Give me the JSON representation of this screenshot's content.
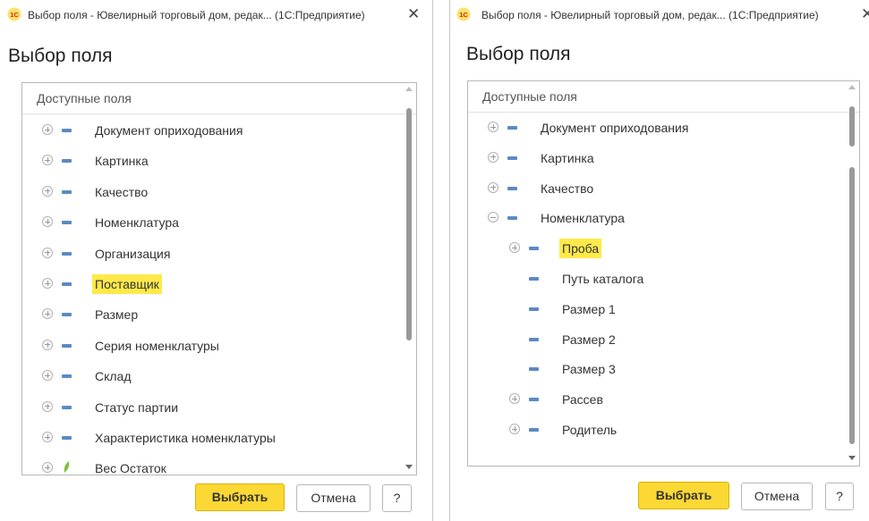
{
  "windows": [
    {
      "title": "Выбор поля - Ювелирный торговый дом, редак... (1С:Предприятие)",
      "form_title": "Выбор поля",
      "panel_header": "Доступные поля",
      "items": [
        {
          "label": "Документ оприходования",
          "expander": "plus",
          "icon": "dash",
          "level": 0
        },
        {
          "label": "Картинка",
          "expander": "plus",
          "icon": "dash",
          "level": 0
        },
        {
          "label": "Качество",
          "expander": "plus",
          "icon": "dash",
          "level": 0
        },
        {
          "label": "Номенклатура",
          "expander": "plus",
          "icon": "dash",
          "level": 0
        },
        {
          "label": "Организация",
          "expander": "plus",
          "icon": "dash",
          "level": 0
        },
        {
          "label": "Поставщик",
          "expander": "plus",
          "icon": "dash",
          "level": 0,
          "selected": true
        },
        {
          "label": "Размер",
          "expander": "plus",
          "icon": "dash",
          "level": 0
        },
        {
          "label": "Серия номенклатуры",
          "expander": "plus",
          "icon": "dash",
          "level": 0
        },
        {
          "label": "Склад",
          "expander": "plus",
          "icon": "dash",
          "level": 0
        },
        {
          "label": "Статус партии",
          "expander": "plus",
          "icon": "dash",
          "level": 0
        },
        {
          "label": "Характеристика номенклатуры",
          "expander": "plus",
          "icon": "dash",
          "level": 0
        },
        {
          "label": "Вес Остаток",
          "expander": "plus",
          "icon": "leaf",
          "level": 0
        }
      ],
      "buttons": {
        "select": "Выбрать",
        "cancel": "Отмена",
        "help": "?"
      }
    },
    {
      "title": "Выбор поля - Ювелирный торговый дом, редак... (1С:Предприятие)",
      "form_title": "Выбор поля",
      "panel_header": "Доступные поля",
      "items": [
        {
          "label": "Документ оприходования",
          "expander": "plus",
          "icon": "dash",
          "level": 0
        },
        {
          "label": "Картинка",
          "expander": "plus",
          "icon": "dash",
          "level": 0
        },
        {
          "label": "Качество",
          "expander": "plus",
          "icon": "dash",
          "level": 0
        },
        {
          "label": "Номенклатура",
          "expander": "minus",
          "icon": "dash",
          "level": 0
        },
        {
          "label": "Проба",
          "expander": "plus",
          "icon": "dash",
          "level": 1,
          "selected": true
        },
        {
          "label": "Путь каталога",
          "expander": "none",
          "icon": "dash",
          "level": 1
        },
        {
          "label": "Размер 1",
          "expander": "none",
          "icon": "dash",
          "level": 1
        },
        {
          "label": "Размер 2",
          "expander": "none",
          "icon": "dash",
          "level": 1
        },
        {
          "label": "Размер 3",
          "expander": "none",
          "icon": "dash",
          "level": 1
        },
        {
          "label": "Рассев",
          "expander": "plus",
          "icon": "dash",
          "level": 1
        },
        {
          "label": "Родитель",
          "expander": "plus",
          "icon": "dash",
          "level": 1
        }
      ],
      "buttons": {
        "select": "Выбрать",
        "cancel": "Отмена",
        "help": "?"
      }
    }
  ],
  "icons": {
    "app": "1c-logo-icon",
    "close": "close-icon",
    "expand": "expand-plus-icon",
    "collapse": "collapse-minus-icon",
    "field": "field-dash-icon",
    "resource": "resource-leaf-icon"
  },
  "colors": {
    "accent": "#fcd835",
    "highlight": "#ffe94a",
    "field_icon": "#5b8ac4",
    "resource_icon": "#7cc13e"
  },
  "close_glyph": "✕"
}
